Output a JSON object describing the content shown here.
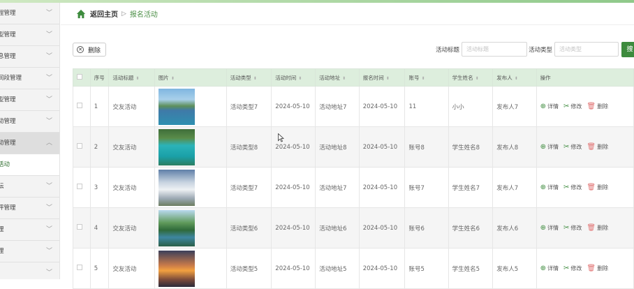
{
  "sidebar": {
    "items": [
      {
        "label": "程管理",
        "type": "group"
      },
      {
        "label": "型管理",
        "type": "group"
      },
      {
        "label": "息管理",
        "type": "group"
      },
      {
        "label": "间段管理",
        "type": "group"
      },
      {
        "label": "型管理",
        "type": "group"
      },
      {
        "label": "动管理",
        "type": "group"
      },
      {
        "label": "动管理",
        "type": "open"
      },
      {
        "label": "活动",
        "type": "sub"
      },
      {
        "label": "坛",
        "type": "group"
      },
      {
        "label": "评管理",
        "type": "group"
      },
      {
        "label": "理",
        "type": "group"
      },
      {
        "label": "理",
        "type": "group"
      },
      {
        "label": "",
        "type": "group"
      }
    ]
  },
  "breadcrumb": {
    "home": "返回主页",
    "separator": "▷",
    "current": "报名活动"
  },
  "toolbar": {
    "delete_label": "删除",
    "title_label": "活动标题",
    "title_placeholder": "活动标题",
    "type_label": "活动类型",
    "type_placeholder": "活动类型",
    "search_label": "捜"
  },
  "table": {
    "headers": [
      "序号",
      "活动标题",
      "图片",
      "活动类型",
      "活动时间",
      "活动地址",
      "报名时间",
      "账号",
      "学生姓名",
      "发布人",
      "操作"
    ],
    "actions": {
      "detail": "详情",
      "edit": "修改",
      "delete": "删除"
    },
    "rows": [
      {
        "idx": "1",
        "title": "交友活动",
        "image": "lake-mountains",
        "type": "活动类型7",
        "time": "2024-05-10",
        "address": "活动地址7",
        "signup": "2024-05-10",
        "account": "11",
        "student": "小小",
        "publisher": "发布人7"
      },
      {
        "idx": "2",
        "title": "交友活动",
        "image": "turquoise-bay",
        "type": "活动类型8",
        "time": "2024-05-10",
        "address": "活动地址8",
        "signup": "2024-05-10",
        "account": "账号8",
        "student": "学生姓名8",
        "publisher": "发布人8"
      },
      {
        "idx": "3",
        "title": "交友活动",
        "image": "cloudy-sky",
        "type": "活动类型7",
        "time": "2024-05-10",
        "address": "活动地址7",
        "signup": "2024-05-10",
        "account": "账号7",
        "student": "学生姓名7",
        "publisher": "发布人7"
      },
      {
        "idx": "4",
        "title": "交友活动",
        "image": "forest-lake",
        "type": "活动类型6",
        "time": "2024-05-10",
        "address": "活动地址6",
        "signup": "2024-05-10",
        "account": "账号6",
        "student": "学生姓名6",
        "publisher": "发布人6"
      },
      {
        "idx": "5",
        "title": "交友活动",
        "image": "sunset",
        "type": "活动类型5",
        "time": "2024-05-10",
        "address": "活动地址5",
        "signup": "2024-05-10",
        "account": "账号5",
        "student": "学生姓名5",
        "publisher": "发布人5"
      }
    ]
  },
  "colors": {
    "accent": "#3d8b3d",
    "header_bg": "#ddeedd",
    "danger": "#e07070"
  }
}
